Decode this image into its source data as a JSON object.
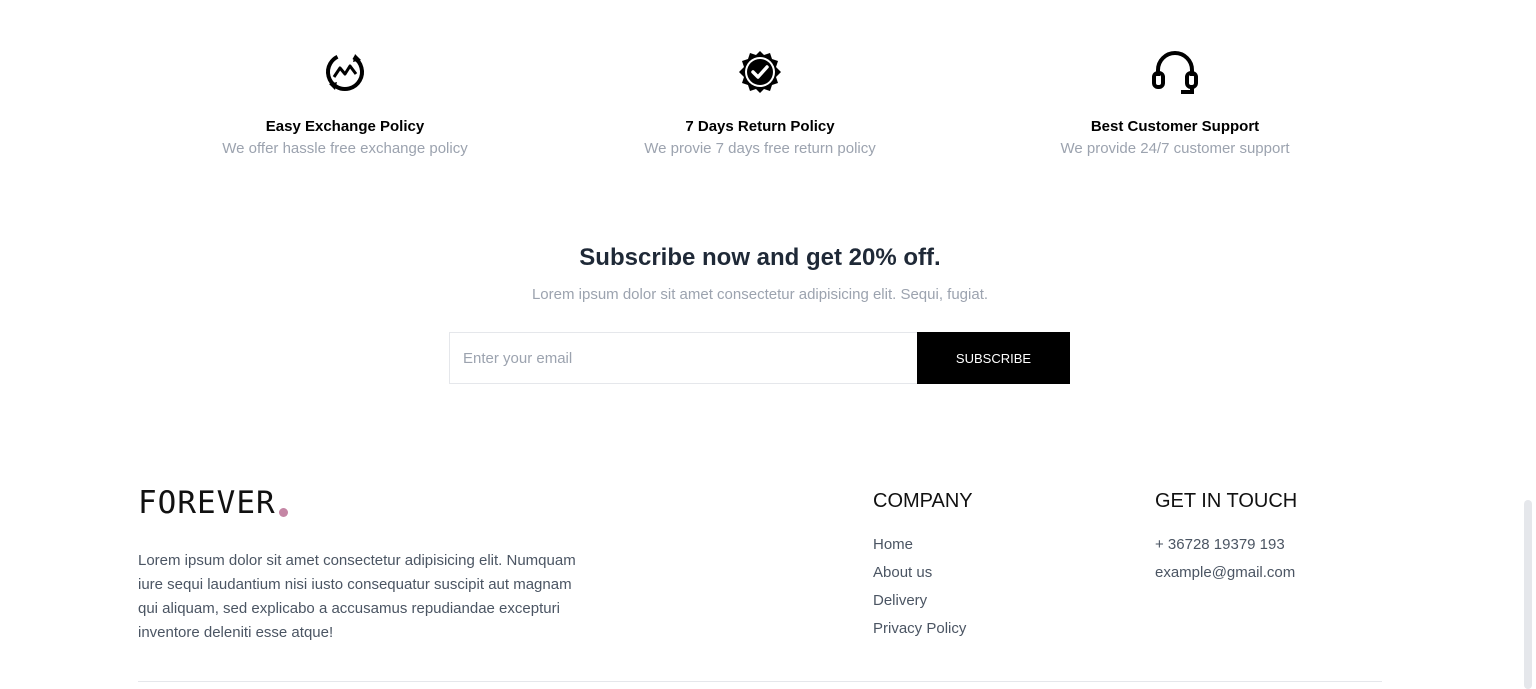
{
  "policies": [
    {
      "icon": "exchange-icon",
      "title": "Easy Exchange Policy",
      "desc": "We offer hassle free exchange policy"
    },
    {
      "icon": "quality-badge-icon",
      "title": "7 Days Return Policy",
      "desc": "We provie 7 days free return policy"
    },
    {
      "icon": "headset-icon",
      "title": "Best Customer Support",
      "desc": "We provide 24/7 customer support"
    }
  ],
  "subscribe": {
    "title": "Subscribe now and get 20% off.",
    "subtitle": "Lorem ipsum dolor sit amet consectetur adipisicing elit. Sequi, fugiat.",
    "placeholder": "Enter your email",
    "button": "SUBSCRIBE"
  },
  "footer": {
    "logo": "FOREVER",
    "accent_color": "#c586a5",
    "about": "Lorem ipsum dolor sit amet consectetur adipisicing elit. Numquam iure sequi laudantium nisi iusto consequatur suscipit aut magnam qui aliquam, sed explicabo a accusamus repudiandae excepturi inventore deleniti esse atque!",
    "company": {
      "title": "COMPANY",
      "links": [
        "Home",
        "About us",
        "Delivery",
        "Privacy Policy"
      ]
    },
    "contact": {
      "title": "GET IN TOUCH",
      "phone": "+ 36728 19379 193",
      "email": "example@gmail.com"
    }
  }
}
